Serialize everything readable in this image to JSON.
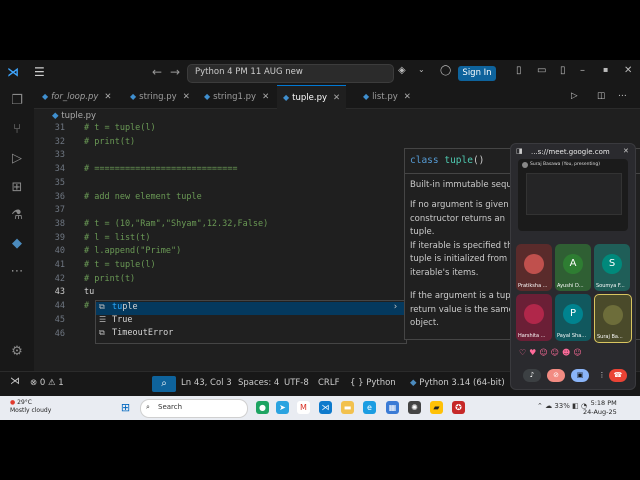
{
  "titlebar": {
    "command_center": "Python 4 PM 11 AUG new",
    "sign_in": "Sign In"
  },
  "tabs": [
    {
      "label": "for_loop.py",
      "italic": true
    },
    {
      "label": "string.py"
    },
    {
      "label": "string1.py"
    },
    {
      "label": "tuple.py",
      "active": true
    },
    {
      "label": "list.py"
    }
  ],
  "breadcrumb": "tuple.py",
  "editor": {
    "lines": [
      {
        "n": "31",
        "text": "# t = tuple(l)"
      },
      {
        "n": "32",
        "text": "# print(t)"
      },
      {
        "n": "33",
        "text": ""
      },
      {
        "n": "34",
        "text": "# ============================"
      },
      {
        "n": "35",
        "text": ""
      },
      {
        "n": "36",
        "text": "# add new element tuple"
      },
      {
        "n": "37",
        "text": ""
      },
      {
        "n": "38",
        "text": "# t = (10,\"Ram\",\"Shyam\",12.32,False)"
      },
      {
        "n": "39",
        "text": "# l = list(t)"
      },
      {
        "n": "40",
        "text": "# l.append(\"Prime\")"
      },
      {
        "n": "41",
        "text": "# t = tuple(l)"
      },
      {
        "n": "42",
        "text": "# print(t)"
      },
      {
        "n": "43",
        "text": "tu"
      },
      {
        "n": "44",
        "text": "#"
      },
      {
        "n": "45",
        "text": ""
      },
      {
        "n": "46",
        "text": ""
      }
    ]
  },
  "suggest": {
    "items": [
      {
        "match": "tu",
        "rest": "ple",
        "icon": "class-icon"
      },
      {
        "match": "",
        "rest": "True",
        "icon": "keyword-icon"
      },
      {
        "match": "",
        "rest": "TimeoutError",
        "icon": "class-icon"
      }
    ]
  },
  "hover": {
    "kw": "class",
    "name": "tuple",
    "parens": "()",
    "paras": [
      "Built-in immutable sequ",
      "If no argument is given",
      "constructor returns an",
      "tuple.",
      "If iterable is specified th",
      "tuple is initialized from",
      "iterable's items.",
      "If the argument is a tup",
      "return value is the same",
      "object."
    ]
  },
  "statusbar": {
    "errors": "0",
    "warnings": "1",
    "position": "Ln 43, Col 3",
    "spaces": "Spaces: 4",
    "encoding": "UTF-8",
    "eol": "CRLF",
    "language": "Python",
    "interpreter": "Python 3.14 (64-bit)"
  },
  "meet": {
    "url": "...s://meet.google.com",
    "presenter": "Suraj Basawa (You, presenting)",
    "participants": [
      {
        "initial": "",
        "name": "Pratiksha ...",
        "color": "#c0504d"
      },
      {
        "initial": "A",
        "name": "Ayushi D...",
        "color": "#2e7d32"
      },
      {
        "initial": "S",
        "name": "Soumya F...",
        "color": "#00897b"
      },
      {
        "initial": "",
        "name": "Harshita ...",
        "color": "#b0274a"
      },
      {
        "initial": "P",
        "name": "Payal Sha...",
        "color": "#00838f"
      },
      {
        "initial": "",
        "name": "Suraj Ba...",
        "color": "#6d6d3a"
      }
    ]
  },
  "taskbar": {
    "temp": "29°C",
    "weather": "Mostly cloudy",
    "search": "Search",
    "time": "5:18 PM",
    "date": "24-Aug-25"
  }
}
